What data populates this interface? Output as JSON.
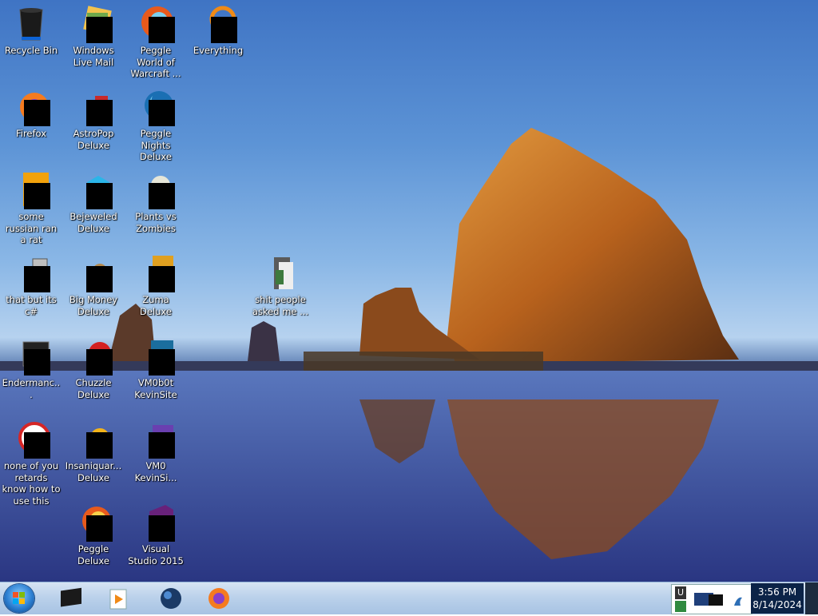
{
  "desktop": {
    "icons": [
      {
        "label": "Recycle Bin"
      },
      {
        "label": "Windows Live Mail"
      },
      {
        "label": "Peggle World of Warcraft ..."
      },
      {
        "label": "Everything"
      },
      {
        "label": "Firefox"
      },
      {
        "label": "AstroPop Deluxe"
      },
      {
        "label": "Peggle Nights Deluxe"
      },
      {
        "label": "some russian ran a rat"
      },
      {
        "label": "Bejeweled Deluxe"
      },
      {
        "label": "Plants vs Zombies"
      },
      {
        "label": "that but its c#"
      },
      {
        "label": "Big Money Deluxe"
      },
      {
        "label": "Zuma Deluxe"
      },
      {
        "label": "shit people asked me ..."
      },
      {
        "label": "Endermanc..."
      },
      {
        "label": "Chuzzle Deluxe"
      },
      {
        "label": "VM0b0t KevinSite"
      },
      {
        "label": "none of you retards know how to use this"
      },
      {
        "label": "Insaniquar... Deluxe"
      },
      {
        "label": "VM0 KevinSi..."
      },
      {
        "label": "Peggle Deluxe"
      },
      {
        "label": "Visual Studio 2015"
      }
    ]
  },
  "taskbar": {
    "start_icon": "windows-orb-icon",
    "pinned": [
      {
        "name": "terminal-icon"
      },
      {
        "name": "media-player-icon"
      },
      {
        "name": "globe-icon"
      },
      {
        "name": "firefox-icon"
      }
    ],
    "tray": {
      "letter": "U",
      "clock_time": "3:56 PM",
      "clock_date": "8/14/2024"
    }
  }
}
